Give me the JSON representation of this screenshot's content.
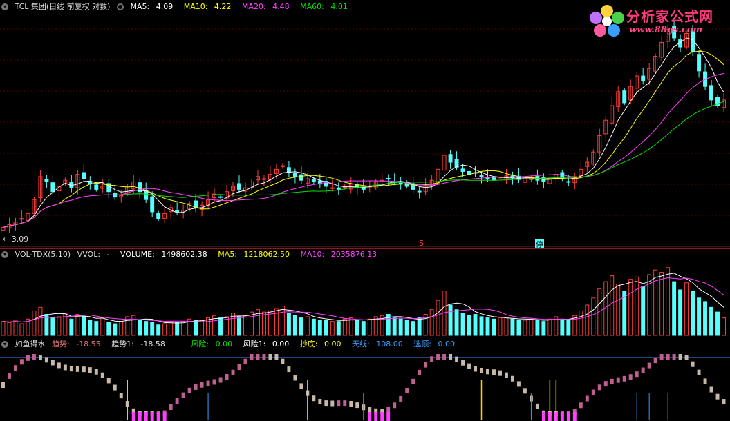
{
  "main_header": {
    "title": "TCL 集团(日线 前复权 对数)",
    "ma5_label": "MA5:",
    "ma5": "4.09",
    "ma10_label": "MA10:",
    "ma10": "4.22",
    "ma20_label": "MA20:",
    "ma20": "4.48",
    "ma60_label": "MA60:",
    "ma60": "4.01"
  },
  "low_price_label": "← 3.09",
  "markers": {
    "s_mark": "S",
    "stop_mark": "停"
  },
  "watermark": {
    "cn": "分析家公式网",
    "url": "www.88gs.com"
  },
  "vol_header": {
    "name": "VOL-TDX(5,10)",
    "vvol_label": "VVOL:",
    "vvol": "-",
    "volume_label": "VOLUME:",
    "volume": "1498602.38",
    "ma5_label": "MA5:",
    "ma5": "1218062.50",
    "ma10_label": "MA10:",
    "ma10": "2035876.13"
  },
  "ind_header": {
    "name": "如鱼得水",
    "trend_label": "趋势:",
    "trend": "-18.55",
    "trend1_label": "趋势1:",
    "trend1": "-18.58",
    "risk_label": "风险:",
    "risk": "0.00",
    "risk1_label": "风险1:",
    "risk1": "0.00",
    "bottom_label": "抄底:",
    "bottom": "0.00",
    "sky_label": "天线:",
    "sky": "108.00",
    "top_label": "逃顶:",
    "top": "0.00"
  },
  "colors": {
    "up": "#ff3d3d",
    "down": "#54ffff",
    "ma5": "#ffffff",
    "ma10": "#ffff00",
    "ma20": "#ff40ff",
    "ma60": "#00e000",
    "ind_up": "#c06090",
    "ind_down": "#c8b8a8"
  },
  "chart_data": {
    "type": "candlestick",
    "log_scale": true,
    "close": [
      3.12,
      3.15,
      3.18,
      3.22,
      3.28,
      3.45,
      3.75,
      3.68,
      3.55,
      3.62,
      3.7,
      3.6,
      3.78,
      3.72,
      3.65,
      3.58,
      3.62,
      3.55,
      3.48,
      3.5,
      3.62,
      3.68,
      3.55,
      3.45,
      3.3,
      3.22,
      3.28,
      3.35,
      3.3,
      3.32,
      3.4,
      3.35,
      3.38,
      3.45,
      3.52,
      3.48,
      3.55,
      3.62,
      3.58,
      3.6,
      3.68,
      3.75,
      3.72,
      3.78,
      3.85,
      3.9,
      3.8,
      3.75,
      3.7,
      3.72,
      3.68,
      3.65,
      3.62,
      3.6,
      3.58,
      3.62,
      3.65,
      3.6,
      3.58,
      3.62,
      3.68,
      3.7,
      3.72,
      3.68,
      3.65,
      3.62,
      3.58,
      3.55,
      3.62,
      3.7,
      3.85,
      4.05,
      3.95,
      3.88,
      3.82,
      3.78,
      3.8,
      3.75,
      3.72,
      3.7,
      3.74,
      3.76,
      3.73,
      3.71,
      3.72,
      3.74,
      3.7,
      3.68,
      3.72,
      3.78,
      3.72,
      3.68,
      3.75,
      3.85,
      3.95,
      4.1,
      4.35,
      4.6,
      4.85,
      5.1,
      4.9,
      5.2,
      5.4,
      5.3,
      5.55,
      5.8,
      6.1,
      6.4,
      6.2,
      6.0,
      6.3,
      5.9,
      5.5,
      5.2,
      4.95,
      4.85,
      4.95
    ],
    "volume": [
      1.2,
      1.1,
      1.3,
      1.0,
      1.4,
      2.1,
      2.4,
      1.8,
      1.5,
      1.6,
      1.9,
      1.4,
      1.8,
      1.6,
      1.3,
      1.2,
      1.5,
      1.1,
      1.0,
      1.2,
      1.6,
      1.7,
      1.3,
      1.2,
      1.1,
      0.9,
      1.0,
      1.2,
      1.1,
      1.2,
      1.4,
      1.3,
      1.3,
      1.5,
      1.7,
      1.5,
      1.6,
      1.9,
      1.6,
      1.7,
      2.0,
      2.2,
      2.0,
      2.1,
      2.3,
      2.5,
      1.9,
      1.7,
      1.5,
      1.6,
      1.4,
      1.3,
      1.3,
      1.2,
      1.2,
      1.4,
      1.5,
      1.3,
      1.2,
      1.4,
      1.6,
      1.7,
      1.8,
      1.5,
      1.4,
      1.3,
      1.2,
      1.5,
      1.8,
      2.2,
      3.0,
      3.8,
      2.6,
      2.2,
      1.9,
      1.7,
      1.8,
      1.6,
      1.5,
      1.4,
      1.5,
      1.5,
      1.4,
      1.3,
      1.3,
      1.4,
      1.3,
      1.2,
      1.4,
      1.6,
      1.4,
      1.3,
      1.7,
      2.1,
      2.6,
      3.2,
      4.0,
      4.6,
      5.1,
      4.4,
      3.8,
      4.8,
      5.0,
      4.2,
      5.2,
      5.6,
      5.4,
      5.8,
      4.6,
      3.9,
      4.5,
      3.8,
      3.2,
      2.9,
      2.4,
      2.0,
      1.5
    ]
  }
}
